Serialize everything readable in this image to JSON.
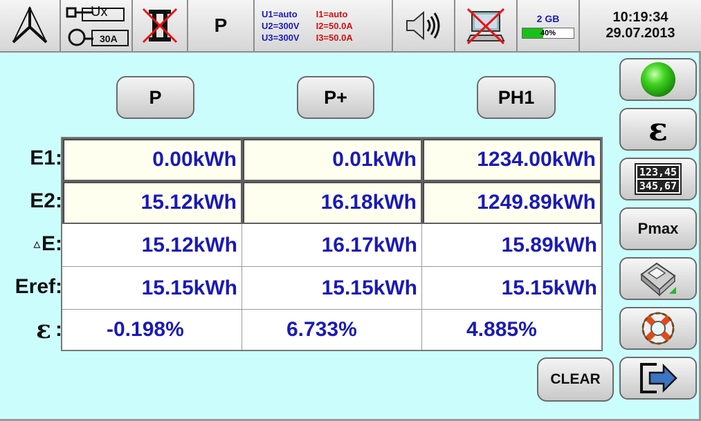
{
  "topbar": {
    "ux_label": "Ux",
    "current_range": "30A",
    "mode": "P",
    "u1": "U1=auto",
    "u2": "U2=300V",
    "u3": "U3=300V",
    "i1": "I1=auto",
    "i2": "I2=50.0A",
    "i3": "I3=50.0A",
    "memory_size": "2 GB",
    "memory_percent_label": "40%",
    "memory_used_fraction": 0.4,
    "time": "10:19:34",
    "date": "29.07.2013"
  },
  "tabs": [
    "P",
    "P+",
    "PH1"
  ],
  "rows": {
    "e1_label": "E1",
    "e2_label": "E2",
    "de_label": "E",
    "eref_label": "Eref",
    "eps_label": "ε"
  },
  "table": {
    "e1": [
      "0.00kWh",
      "0.01kWh",
      "1234.00kWh"
    ],
    "e2": [
      "15.12kWh",
      "16.18kWh",
      "1249.89kWh"
    ],
    "de": [
      "15.12kWh",
      "16.17kWh",
      "15.89kWh"
    ],
    "eref": [
      "15.15kWh",
      "15.15kWh",
      "15.15kWh"
    ],
    "eps": [
      "-0.198%",
      "6.733%",
      "4.885%"
    ]
  },
  "side": {
    "epsilon": "ε",
    "counter_top": "123,45",
    "counter_bottom": "345,67",
    "pmax": "Pmax",
    "status_color": "#2ecc17"
  },
  "clear_label": "CLEAR",
  "colors": {
    "background": "#ccfdfd",
    "value_blue": "#1a1ab8",
    "range_red": "#d01010"
  }
}
